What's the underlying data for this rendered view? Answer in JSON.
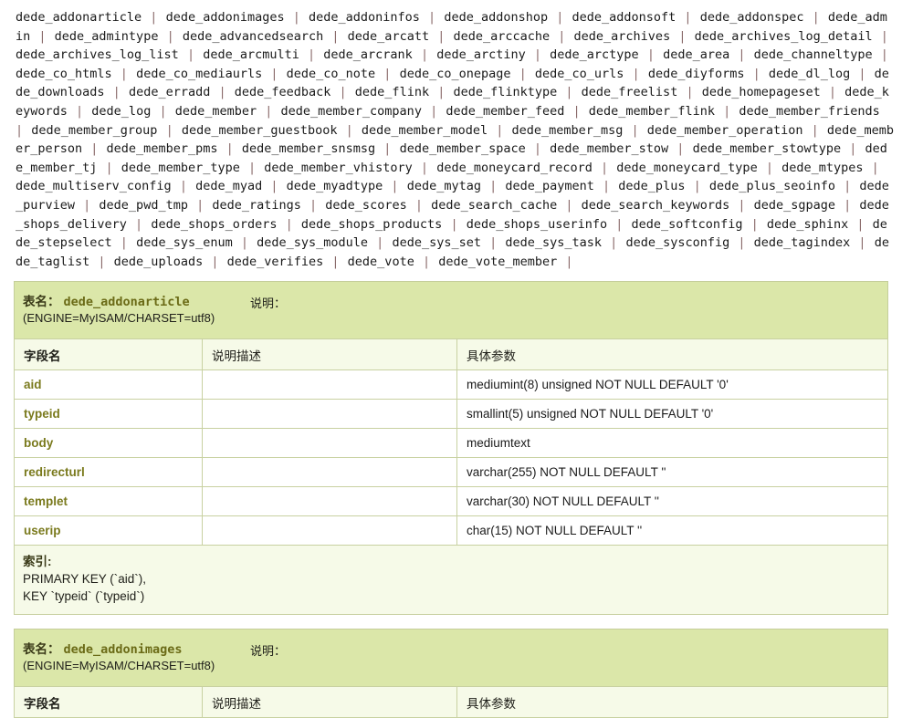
{
  "table_name_list": {
    "separator": "|",
    "names": [
      "dede_addonarticle",
      "dede_addonimages",
      "dede_addoninfos",
      "dede_addonshop",
      "dede_addonsoft",
      "dede_addonspec",
      "dede_admin",
      "dede_admintype",
      "dede_advancedsearch",
      "dede_arcatt",
      "dede_arccache",
      "dede_archives",
      "dede_archives_log_detail",
      "dede_archives_log_list",
      "dede_arcmulti",
      "dede_arcrank",
      "dede_arctiny",
      "dede_arctype",
      "dede_area",
      "dede_channeltype",
      "dede_co_htmls",
      "dede_co_mediaurls",
      "dede_co_note",
      "dede_co_onepage",
      "dede_co_urls",
      "dede_diyforms",
      "dede_dl_log",
      "dede_downloads",
      "dede_erradd",
      "dede_feedback",
      "dede_flink",
      "dede_flinktype",
      "dede_freelist",
      "dede_homepageset",
      "dede_keywords",
      "dede_log",
      "dede_member",
      "dede_member_company",
      "dede_member_feed",
      "dede_member_flink",
      "dede_member_friends",
      "dede_member_group",
      "dede_member_guestbook",
      "dede_member_model",
      "dede_member_msg",
      "dede_member_operation",
      "dede_member_person",
      "dede_member_pms",
      "dede_member_snsmsg",
      "dede_member_space",
      "dede_member_stow",
      "dede_member_stowtype",
      "dede_member_tj",
      "dede_member_type",
      "dede_member_vhistory",
      "dede_moneycard_record",
      "dede_moneycard_type",
      "dede_mtypes",
      "dede_multiserv_config",
      "dede_myad",
      "dede_myadtype",
      "dede_mytag",
      "dede_payment",
      "dede_plus",
      "dede_plus_seoinfo",
      "dede_purview",
      "dede_pwd_tmp",
      "dede_ratings",
      "dede_scores",
      "dede_search_cache",
      "dede_search_keywords",
      "dede_sgpage",
      "dede_shops_delivery",
      "dede_shops_orders",
      "dede_shops_products",
      "dede_shops_userinfo",
      "dede_softconfig",
      "dede_sphinx",
      "dede_stepselect",
      "dede_sys_enum",
      "dede_sys_module",
      "dede_sys_set",
      "dede_sys_task",
      "dede_sysconfig",
      "dede_tagindex",
      "dede_taglist",
      "dede_uploads",
      "dede_verifies",
      "dede_vote",
      "dede_vote_member"
    ]
  },
  "labels": {
    "table_name_prefix": "表名：",
    "note_label": "说明：",
    "index_label": "索引:",
    "col_field": "字段名",
    "col_desc": "说明描述",
    "col_param": "具体参数"
  },
  "colors": {
    "header_band": "#dbe7a9",
    "header_row": "#f6fae8",
    "border": "#c8d1a1",
    "table_name": "#6b6b17",
    "field_name": "#7a7a1d"
  },
  "schemas": [
    {
      "name": "dede_addonarticle",
      "engine": "(ENGINE=MyISAM/CHARSET=utf8)",
      "note": "",
      "rows": [
        {
          "field": "aid",
          "desc": "",
          "param": "mediumint(8) unsigned NOT NULL DEFAULT '0'"
        },
        {
          "field": "typeid",
          "desc": "",
          "param": "smallint(5) unsigned NOT NULL DEFAULT '0'"
        },
        {
          "field": "body",
          "desc": "",
          "param": "mediumtext"
        },
        {
          "field": "redirecturl",
          "desc": "",
          "param": "varchar(255) NOT NULL DEFAULT ''"
        },
        {
          "field": "templet",
          "desc": "",
          "param": "varchar(30) NOT NULL DEFAULT ''"
        },
        {
          "field": "userip",
          "desc": "",
          "param": "char(15) NOT NULL DEFAULT ''"
        }
      ],
      "index_lines": [
        "PRIMARY KEY (`aid`),",
        "KEY `typeid` (`typeid`)"
      ]
    },
    {
      "name": "dede_addonimages",
      "engine": "(ENGINE=MyISAM/CHARSET=utf8)",
      "note": "",
      "rows": [],
      "index_lines": []
    }
  ]
}
